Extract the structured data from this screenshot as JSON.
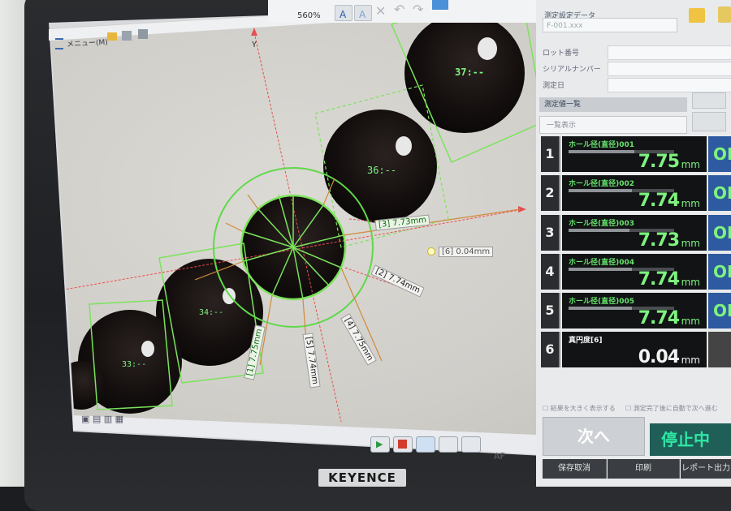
{
  "toolbar": {
    "zoom": "560%",
    "menu_label": "メニュー(M)"
  },
  "image_labels": {
    "axis_y": "Y",
    "particle_37": "37:--",
    "particle_36": "36:--",
    "particle_34": "34:--",
    "particle_33": "33:--",
    "dim_3": "[3] 7.73mm",
    "dim_2": "[2] 7.74mm",
    "dim_4": "[4] 7.75mm",
    "dim_5": "[5] 7.74mm",
    "dim_1": "[1] 7.75mm",
    "roundness": "[6] 0.04mm"
  },
  "right_panel": {
    "title": "測定設定データ",
    "file": "F-001.xxx",
    "fields": [
      "ロット番号",
      "シリアルナンバー",
      "測定日"
    ],
    "section": "測定値一覧",
    "dropdown": "一覧表示"
  },
  "results": [
    {
      "num": "1",
      "name": "ホール径(直径)001",
      "value": "7.75",
      "unit": "mm",
      "judge": "OK",
      "bar": 0.62
    },
    {
      "num": "2",
      "name": "ホール径(直径)002",
      "value": "7.74",
      "unit": "mm",
      "judge": "OK",
      "bar": 0.6
    },
    {
      "num": "3",
      "name": "ホール径(直径)003",
      "value": "7.73",
      "unit": "mm",
      "judge": "OK",
      "bar": 0.58
    },
    {
      "num": "4",
      "name": "ホール径(直径)004",
      "value": "7.74",
      "unit": "mm",
      "judge": "OK",
      "bar": 0.6
    },
    {
      "num": "5",
      "name": "ホール径(直径)005",
      "value": "7.74",
      "unit": "mm",
      "judge": "OK",
      "bar": 0.6
    },
    {
      "num": "6",
      "name": "真円度[6]",
      "value": "0.04",
      "unit": "mm",
      "judge": "",
      "bar": 0
    }
  ],
  "controls": {
    "checkbox_1": "結果を大きく表示する",
    "checkbox_2": "測定完了後に自動で次へ進む",
    "next": "次へ",
    "stop": "停止中",
    "footer": [
      "保存取消",
      "印刷",
      "レポート出力"
    ],
    "af": "AF"
  },
  "brand": "KEYENCE"
}
